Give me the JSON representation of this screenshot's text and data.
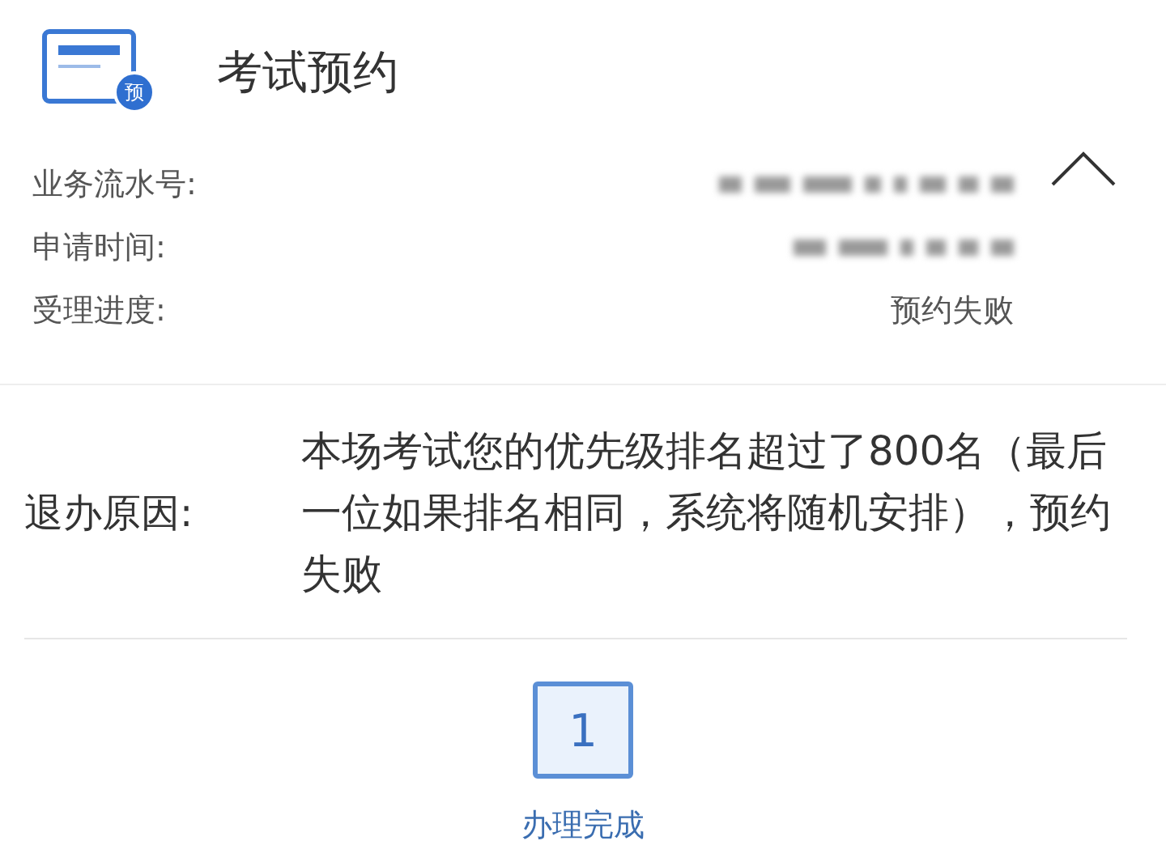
{
  "header": {
    "title": "考试预约",
    "icon_badge": "预",
    "expanded": true
  },
  "info_rows": [
    {
      "label": "业务流水号:",
      "redacted": true
    },
    {
      "label": "申请时间:",
      "redacted": true
    },
    {
      "label": "受理进度:",
      "redacted": false,
      "value": "预约失败"
    }
  ],
  "reason": {
    "label": "退办原因:",
    "text": "本场考试您的优先级排名超过了800名（最后一位如果排名相同，系统将随机安排），预约失败"
  },
  "steps": [
    {
      "number": "1",
      "label": "办理完成",
      "selected": true
    }
  ]
}
